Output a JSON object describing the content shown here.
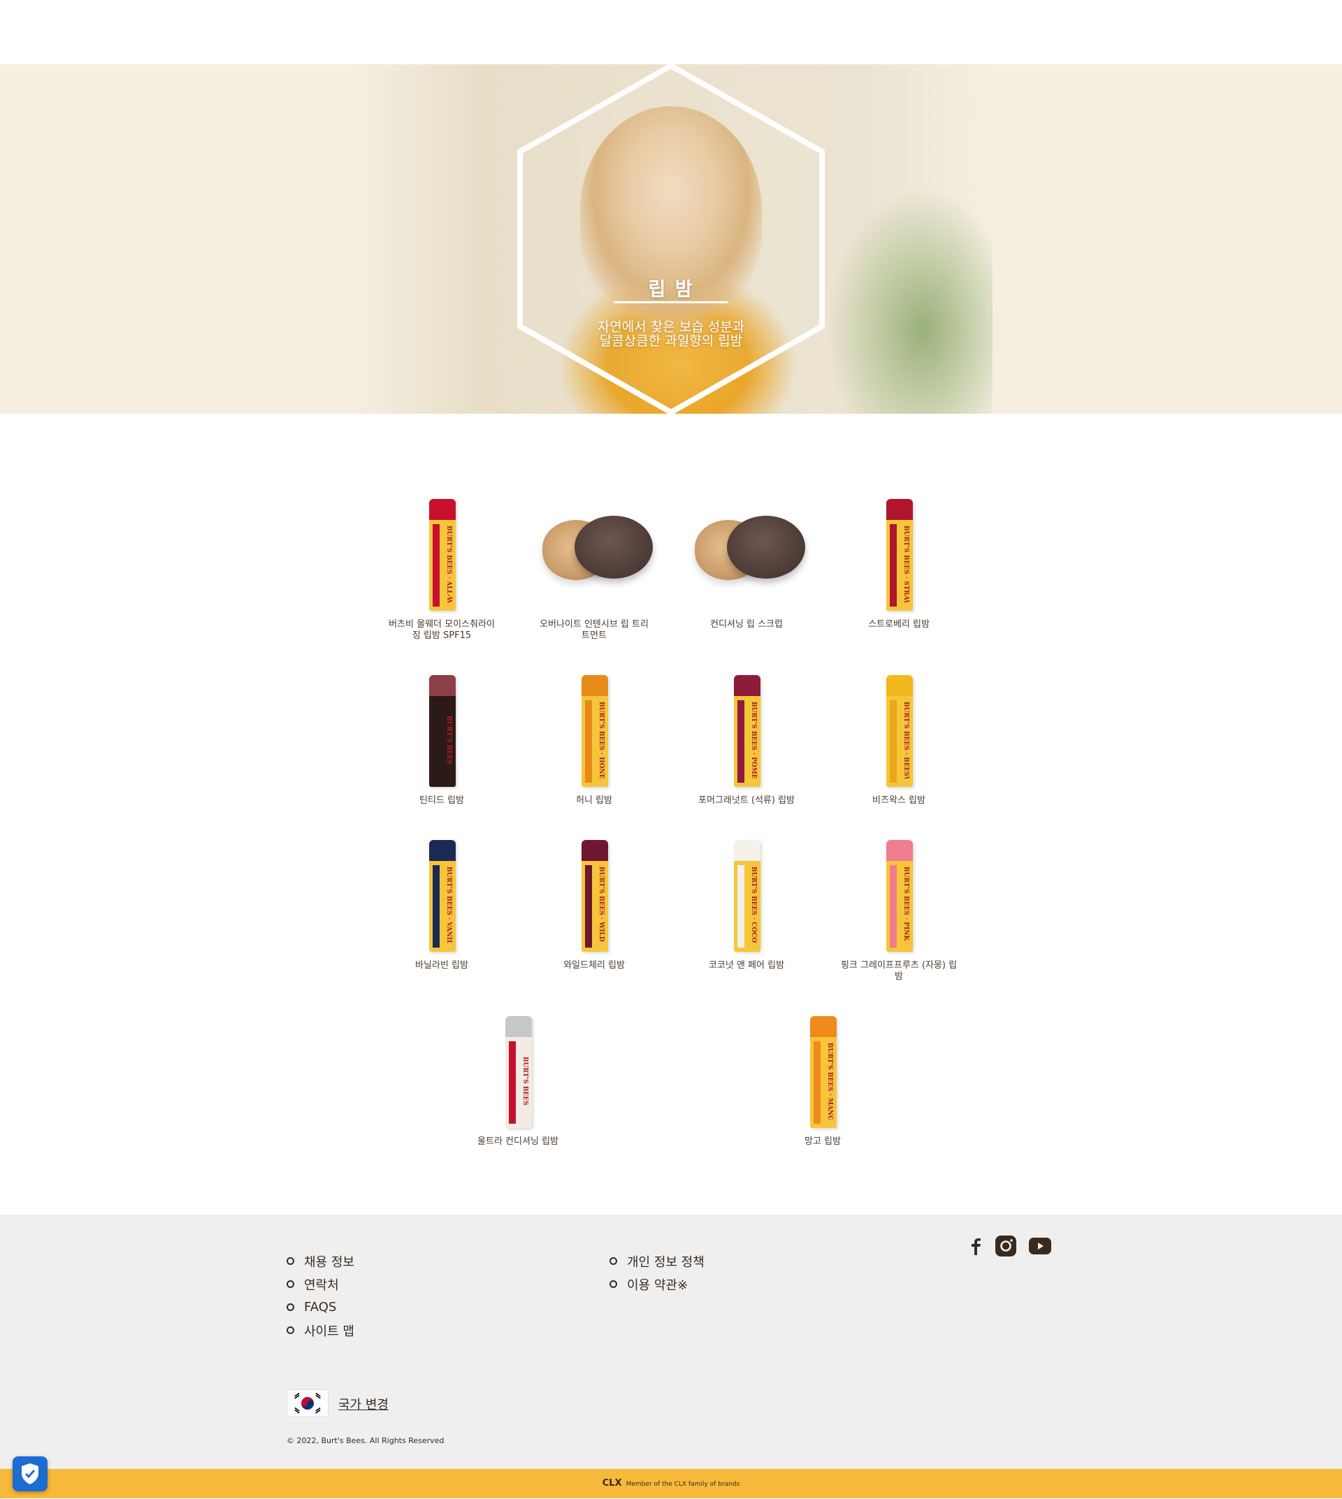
{
  "hero": {
    "title": "립 밤",
    "subtitle_line1": "자연에서 찾은 보습 성분과",
    "subtitle_line2": "달콤상큼한 과일향의 립밤"
  },
  "products": [
    {
      "name_l1": "버츠비 올웨더 모이스춰라이",
      "name_l2": "징 립밤 SPF15",
      "kind": "tube",
      "cap": "#c8102e",
      "stripe": "#c8102e",
      "brand": "BURT'S BEES · ALL-WEATHER"
    },
    {
      "name_l1": "오버나이트 인텐시브 립 트리",
      "name_l2": "트먼트",
      "kind": "jar"
    },
    {
      "name_l1": "컨디셔닝 립 스크럽",
      "name_l2": "",
      "kind": "jar"
    },
    {
      "name_l1": "스트로베리 립밤",
      "name_l2": "",
      "kind": "tube",
      "cap": "#b0152e",
      "stripe": "#b0152e",
      "brand": "BURT'S BEES · STRAWBERRY"
    },
    {
      "name_l1": "틴티드 립밤",
      "name_l2": "",
      "kind": "tube",
      "cap": "#8c3f45",
      "stripe": "#2b1a17",
      "brand": "BURT'S BEES",
      "body": "#2b1a17"
    },
    {
      "name_l1": "허니 립밤",
      "name_l2": "",
      "kind": "tube",
      "cap": "#e88a1a",
      "stripe": "#e88a1a",
      "brand": "BURT'S BEES · HONEY"
    },
    {
      "name_l1": "포머그래넛트 (석류) 립밤",
      "name_l2": "",
      "kind": "tube",
      "cap": "#8e1b3a",
      "stripe": "#8e1b3a",
      "brand": "BURT'S BEES · POMEGRANATE"
    },
    {
      "name_l1": "비즈왁스 립밤",
      "name_l2": "",
      "kind": "tube",
      "cap": "#f2b81e",
      "stripe": "#e9a81a",
      "brand": "BURT'S BEES · BEESWAX"
    },
    {
      "name_l1": "바닐라빈 립밤",
      "name_l2": "",
      "kind": "tube",
      "cap": "#1b2a55",
      "stripe": "#1b2a55",
      "brand": "BURT'S BEES · VANILLA BEAN"
    },
    {
      "name_l1": "와일드체리 립밤",
      "name_l2": "",
      "kind": "tube",
      "cap": "#6e1730",
      "stripe": "#6e1730",
      "brand": "BURT'S BEES · WILD CHERRY"
    },
    {
      "name_l1": "코코넛 앤 페어 립밤",
      "name_l2": "",
      "kind": "tube",
      "cap": "#f4f1e8",
      "stripe": "#f4f1e8",
      "brand": "BURT'S BEES · COCONUT & PEAR"
    },
    {
      "name_l1": "핑크 그레이프프루츠 (자몽) 립",
      "name_l2": "밤",
      "kind": "tube",
      "cap": "#ef7d8d",
      "stripe": "#ef7d8d",
      "brand": "BURT'S BEES · PINK GRAPEFRUIT"
    },
    {
      "name_l1": "울트라 컨디셔닝 립밤",
      "name_l2": "",
      "kind": "tube",
      "cap": "#c8c8c8",
      "stripe": "#c8102e",
      "brand": "BURT'S BEES",
      "body": "#f2ece4"
    },
    {
      "name_l1": "망고 립밤",
      "name_l2": "",
      "kind": "tube",
      "cap": "#f08a1c",
      "stripe": "#f08a1c",
      "brand": "BURT'S BEES · MANGO"
    }
  ],
  "footer": {
    "links_left": [
      "채용 정보",
      "연락처",
      "FAQS",
      "사이트 맵"
    ],
    "links_right": [
      "개인 정보 정책",
      "이용 약관※"
    ],
    "social_icons": [
      "facebook-icon",
      "instagram-icon",
      "youtube-icon"
    ],
    "country_change": "국가 변경",
    "copyright": "© 2022, Burt's Bees. All Rights Reserved"
  },
  "bottom_bar": {
    "brand": "CLX",
    "tagline": "Member of the CLX family of brands"
  },
  "colors": {
    "hero_bg": "#f6efe1",
    "footer_bg": "#efefef",
    "bottom_bar": "#f7b93a",
    "text_brown": "#3a2a1e"
  }
}
